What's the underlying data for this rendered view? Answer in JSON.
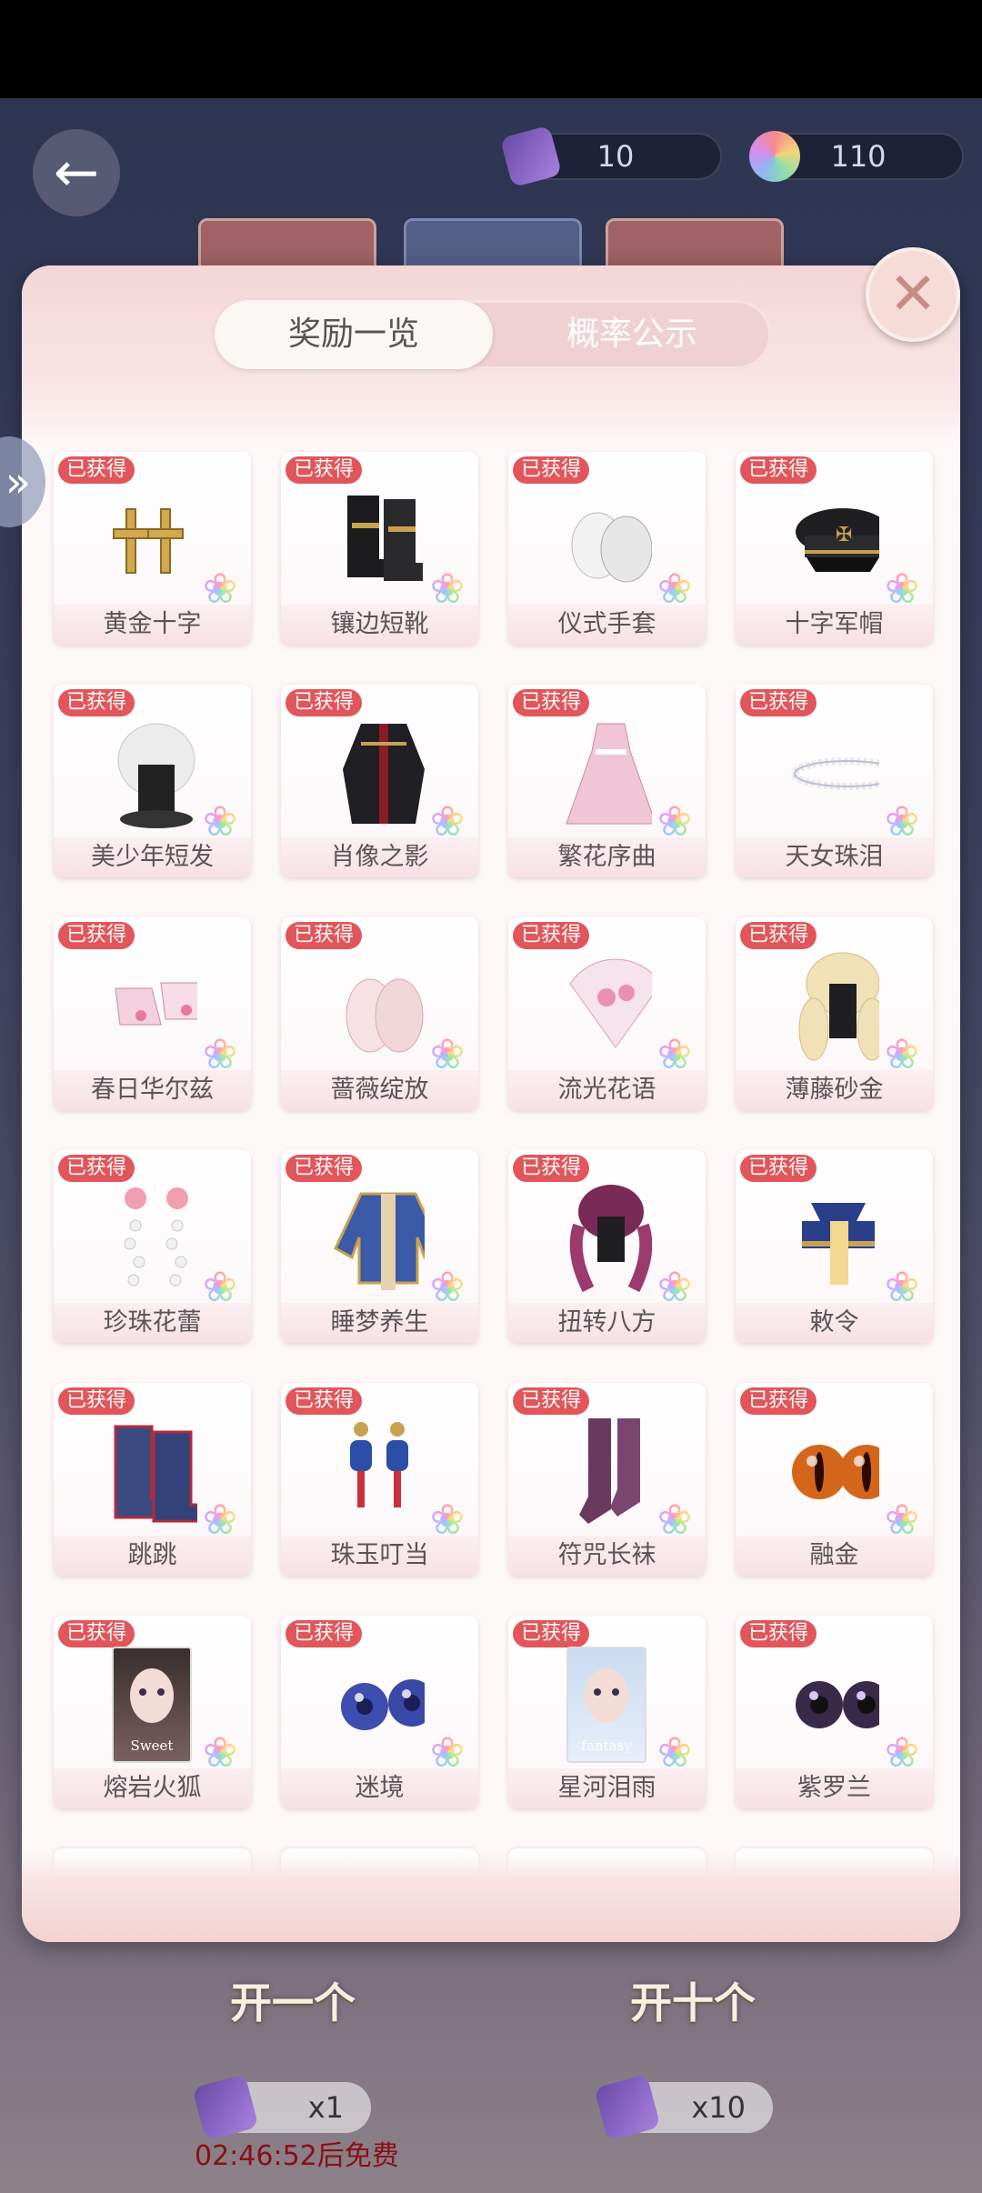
{
  "header": {
    "back_icon": "arrow-left-icon",
    "currency_ticket": {
      "icon": "gift-ticket-icon",
      "value": "10"
    },
    "currency_gem": {
      "icon": "rainbow-gem-icon",
      "value": "110"
    }
  },
  "modal": {
    "tabs": [
      {
        "label": "奖励一览",
        "active": true
      },
      {
        "label": "概率公示",
        "active": false
      }
    ],
    "close_icon": "close-icon",
    "badge_text": "已获得",
    "items": [
      {
        "name": "黄金十字",
        "icon": "gold-cross-earrings-icon"
      },
      {
        "name": "镶边短靴",
        "icon": "black-boots-icon"
      },
      {
        "name": "仪式手套",
        "icon": "white-gloves-icon"
      },
      {
        "name": "十字军帽",
        "icon": "military-cap-icon"
      },
      {
        "name": "美少年短发",
        "icon": "white-short-hair-icon"
      },
      {
        "name": "肖像之影",
        "icon": "black-coat-outfit-icon"
      },
      {
        "name": "繁花序曲",
        "icon": "pink-dress-icon"
      },
      {
        "name": "天女珠泪",
        "icon": "pearl-necklace-icon"
      },
      {
        "name": "春日华尔兹",
        "icon": "pink-shoes-icon"
      },
      {
        "name": "蔷薇绽放",
        "icon": "lace-gloves-icon"
      },
      {
        "name": "流光花语",
        "icon": "flower-fan-icon"
      },
      {
        "name": "薄藤砂金",
        "icon": "blonde-curls-hair-icon"
      },
      {
        "name": "珍珠花蕾",
        "icon": "pearl-earrings-icon"
      },
      {
        "name": "睡梦养生",
        "icon": "blue-jacket-icon"
      },
      {
        "name": "扭转八方",
        "icon": "purple-braids-hair-icon"
      },
      {
        "name": "敕令",
        "icon": "talisman-hat-icon"
      },
      {
        "name": "跳跳",
        "icon": "blue-boots-icon"
      },
      {
        "name": "珠玉叮当",
        "icon": "lantern-earrings-icon"
      },
      {
        "name": "符咒长袜",
        "icon": "purple-stockings-icon"
      },
      {
        "name": "融金",
        "icon": "golden-eyes-icon"
      },
      {
        "name": "熔岩火狐",
        "icon": "makeup-card-sweet-icon",
        "card_text": "Sweet"
      },
      {
        "name": "迷境",
        "icon": "blue-galaxy-eyes-icon"
      },
      {
        "name": "星河泪雨",
        "icon": "makeup-card-fantasy-icon",
        "card_text": "fantasy"
      },
      {
        "name": "紫罗兰",
        "icon": "violet-eyes-icon"
      }
    ],
    "rarity_icon": "rainbow-flower-icon"
  },
  "footer": {
    "open_one_label": "开一个",
    "open_ten_label": "开十个",
    "cost_one": "x1",
    "cost_ten": "x10",
    "timer_text": "02:46:52后免费"
  },
  "colors": {
    "badge": "#e2565b",
    "modal_bg": "#fdf8f8",
    "tab_bar": "#efd1d3"
  }
}
